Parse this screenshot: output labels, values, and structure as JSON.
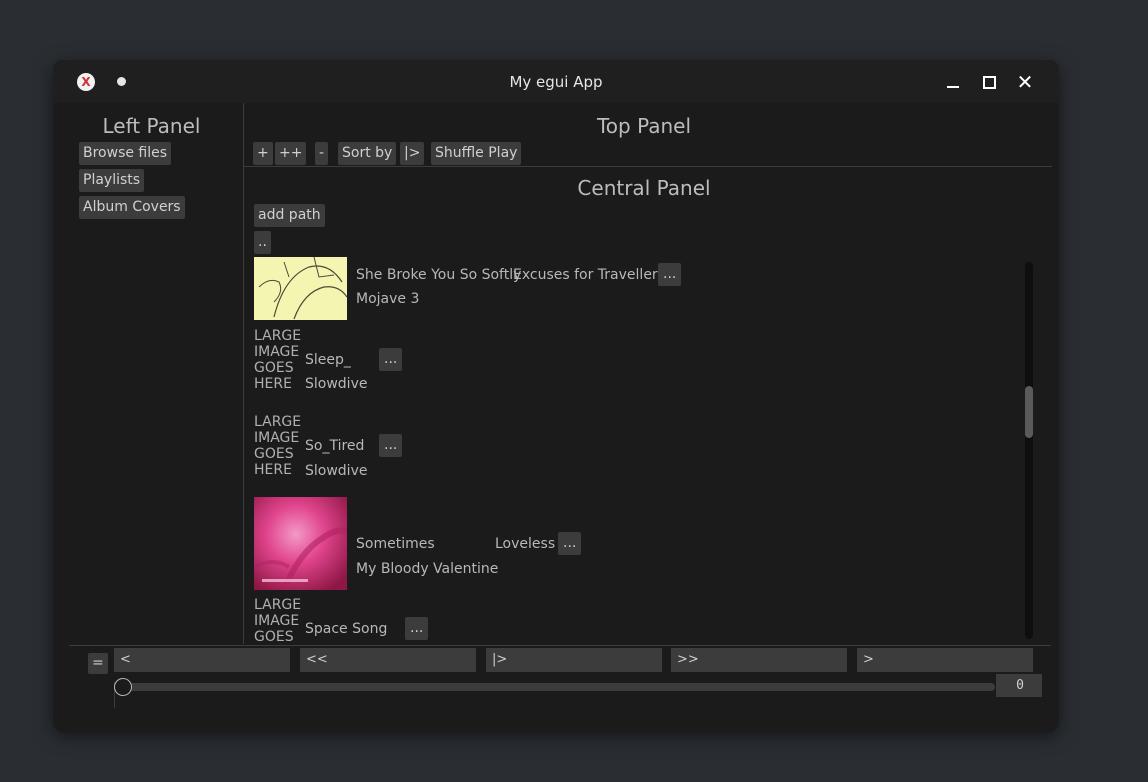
{
  "window": {
    "title": "My egui App"
  },
  "left_panel": {
    "heading": "Left Panel",
    "buttons": [
      "Browse files",
      "Playlists",
      "Album Covers"
    ]
  },
  "top_panel": {
    "heading": "Top Panel",
    "buttons": [
      "+",
      "++",
      "-",
      "Sort by",
      "|>",
      "Shuffle Play"
    ]
  },
  "central_panel": {
    "heading": "Central Panel",
    "add_path_label": "add path",
    "up_dir_label": "..",
    "placeholder_image_lines": [
      "LARGE",
      "IMAGE",
      "GOES",
      "HERE"
    ],
    "tracks": [
      {
        "title": "She Broke You So Softly",
        "album": "Excuses for Travellers",
        "artist": "Mojave 3",
        "menu": "...",
        "cover": "cover-art-yellow"
      },
      {
        "title": "Sleep_",
        "album": "",
        "artist": "Slowdive",
        "menu": "...",
        "cover": "placeholder"
      },
      {
        "title": "So_Tired",
        "album": "",
        "artist": "Slowdive",
        "menu": "...",
        "cover": "placeholder"
      },
      {
        "title": "Sometimes",
        "album": "Loveless",
        "artist": "My Bloody Valentine",
        "menu": "...",
        "cover": "cover-art-pink"
      },
      {
        "title": "Space Song",
        "album": "",
        "artist": "",
        "menu": "...",
        "cover": "placeholder"
      }
    ]
  },
  "bottom_panel": {
    "menu_label": "=",
    "nav_buttons": [
      "<",
      "<<",
      "|>",
      ">>",
      ">"
    ],
    "slider_value": "0",
    "slider_position": 0
  },
  "colors": {
    "desktop": "#2a2e33",
    "window_bg": "#1b1b1b",
    "button_bg": "#3c3c3c",
    "text": "#b8b8b8"
  }
}
